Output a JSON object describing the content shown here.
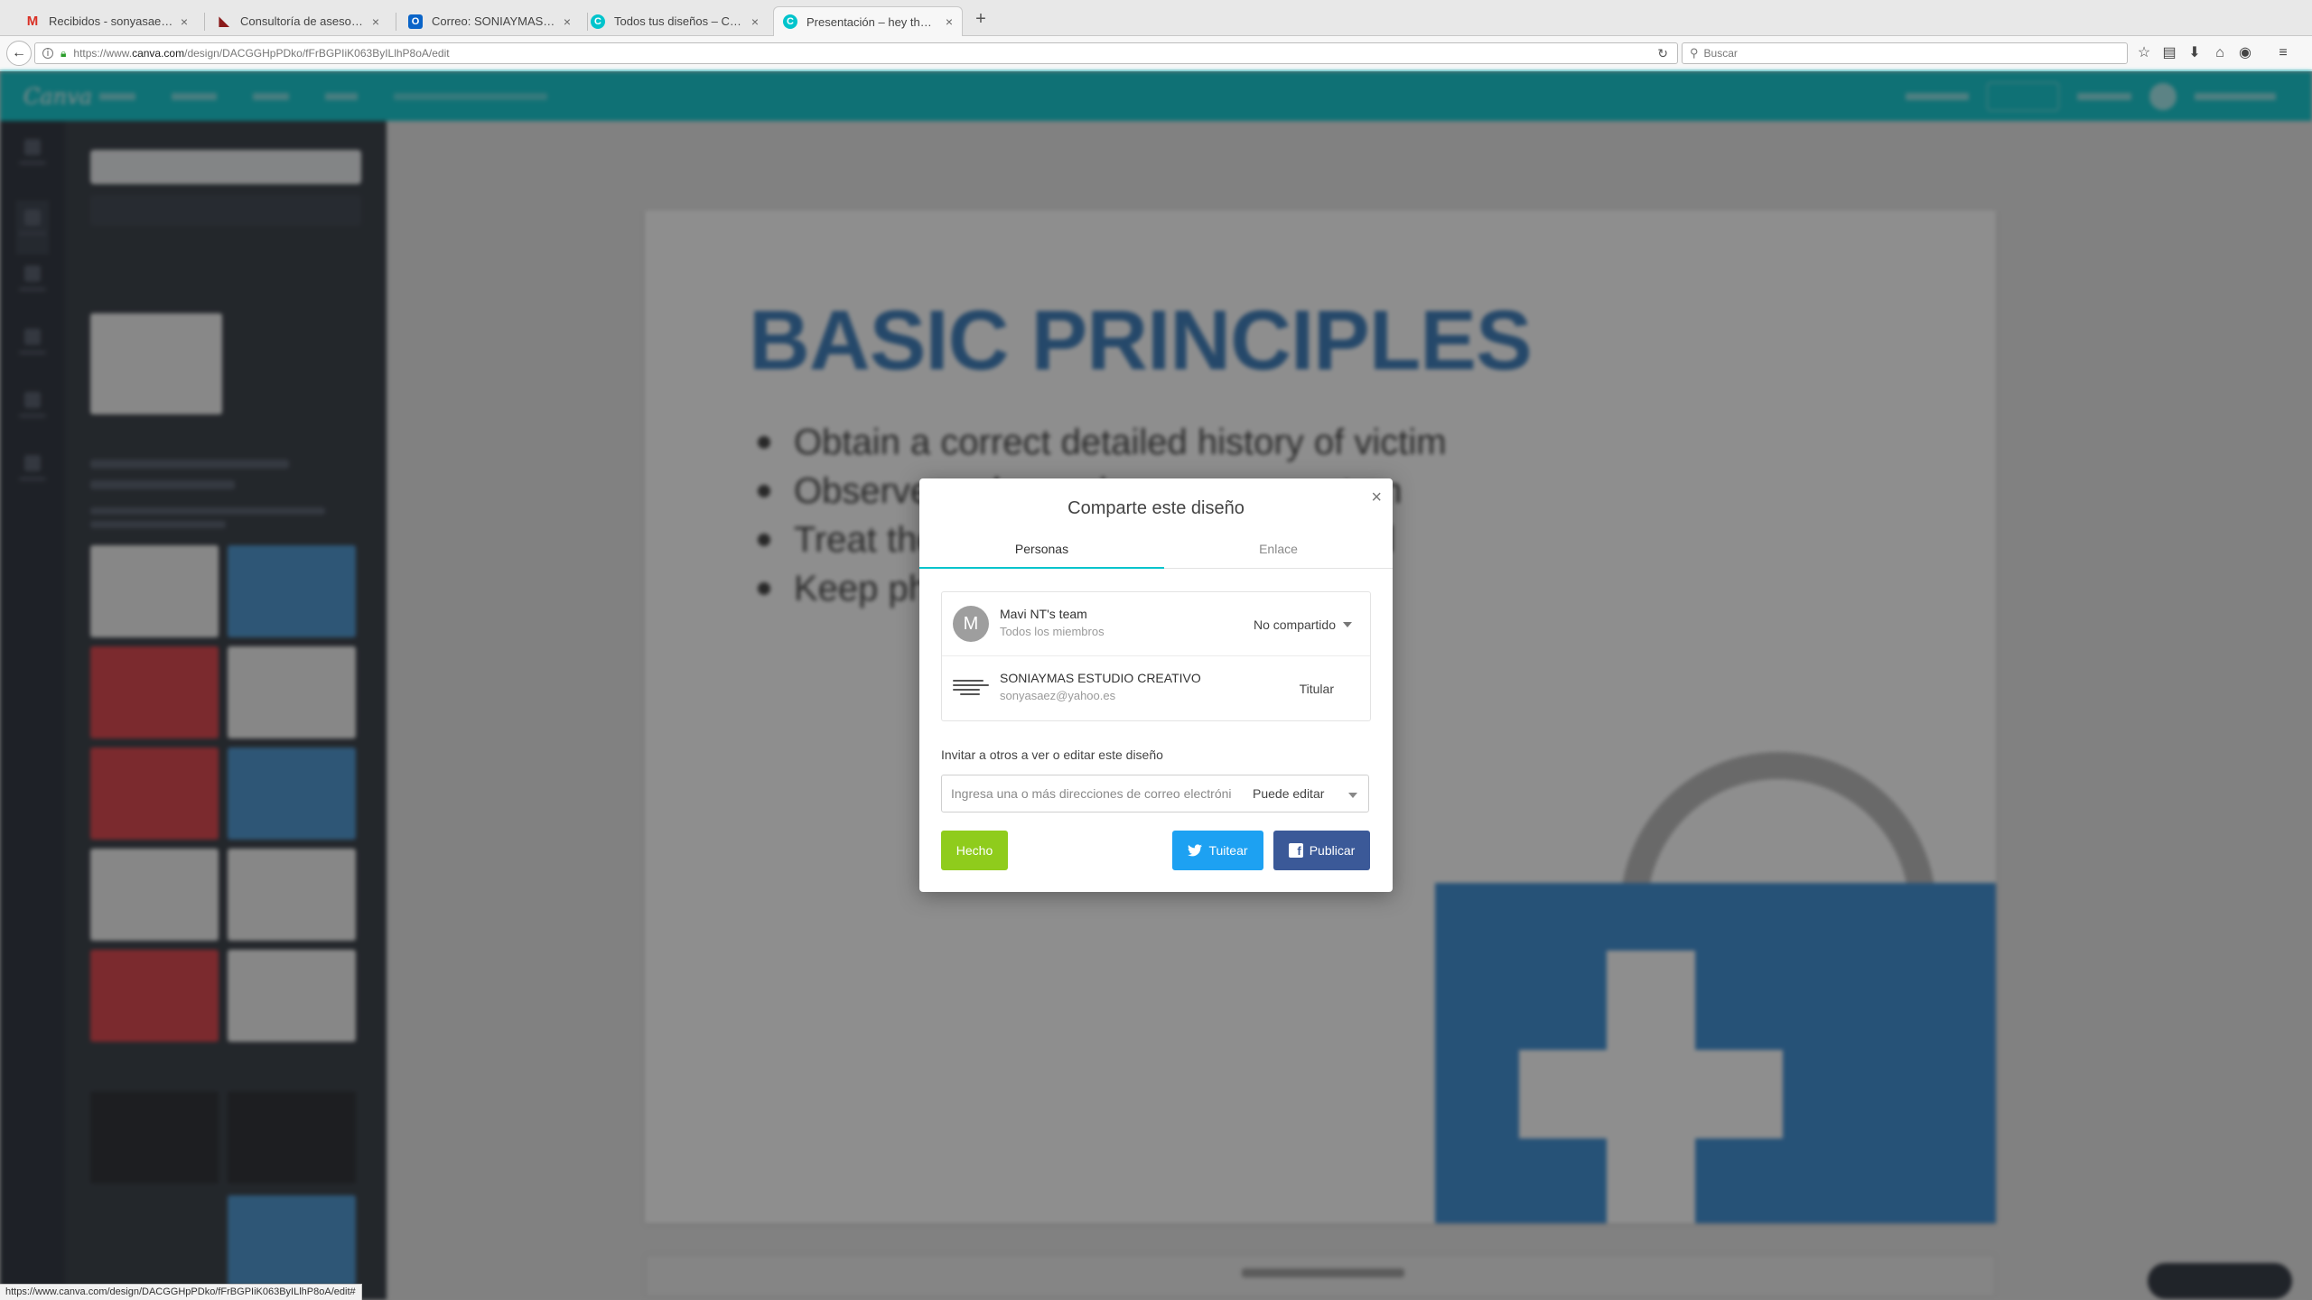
{
  "browser": {
    "tabs": [
      {
        "title": "Recibidos - sonyasaez@g...",
        "favicon": "gmail-icon",
        "color": "#d93025"
      },
      {
        "title": "Consultoría de asesoramie...",
        "favicon": "bookmark-flag-icon",
        "color": "#8b1a1a"
      },
      {
        "title": "Correo: SONIAYMAS CREA...",
        "favicon": "outlook-icon",
        "color": "#0a64c8"
      },
      {
        "title": "Todos tus diseños – Canva",
        "favicon": "canva-icon",
        "color": "#00c4cc"
      },
      {
        "title": "Presentación – hey there!",
        "favicon": "canva-icon",
        "color": "#00c4cc"
      }
    ],
    "url_prefix": "https://www.",
    "url_domain": "canva.com",
    "url_path": "/design/DACGGHpPDko/fFrBGPIiK063ByILlhP8oA/edit",
    "search_placeholder": "Buscar",
    "status_url": "https://www.canva.com/design/DACGGHpPDko/fFrBGPIiK063ByILlhP8oA/edit#"
  },
  "slide": {
    "title": "BASIC PRINCIPLES",
    "bullets": [
      "Obtain a correct detailed history of victim",
      "Observe and examine every symptom",
      "Treat the victim at the nearby hospital",
      "Keep photos and notify the police"
    ]
  },
  "modal": {
    "title": "Comparte este diseño",
    "tab_people": "Personas",
    "tab_link": "Enlace",
    "close": "×",
    "members": [
      {
        "initial": "M",
        "name": "Mavi NT's team",
        "sub": "Todos los miembros",
        "permission": "No compartido"
      },
      {
        "name": "SONIAYMAS ESTUDIO CREATIVO",
        "sub": "sonyasaez@yahoo.es",
        "permission": "Titular"
      }
    ],
    "invite_label": "Invitar a otros a ver o editar este diseño",
    "invite_placeholder": "Ingresa una o más direcciones de correo electrónico",
    "invite_role": "Puede editar",
    "done_label": "Hecho",
    "tweet_label": "Tuitear",
    "publish_label": "Publicar"
  },
  "colors": {
    "brand": "#00c4cc",
    "done": "#8fcc1c",
    "twitter": "#1da1f2",
    "facebook": "#3b5998"
  }
}
